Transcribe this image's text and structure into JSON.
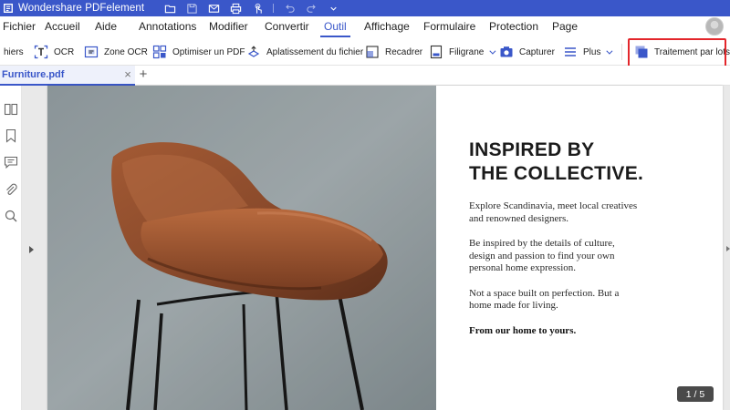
{
  "window": {
    "app_title": "Wondershare PDFelement",
    "app_icon": "pdfelement-logo-icon",
    "quick_access_icons": [
      "folder-icon",
      "save-icon",
      "mail-icon",
      "print-icon",
      "touch-icon",
      "undo-icon",
      "redo-icon",
      "dropdown-icon"
    ]
  },
  "menu": {
    "items": [
      "Fichier",
      "Accueil",
      "Aide",
      "Annotations",
      "Modifier",
      "Convertir",
      "Outil",
      "Affichage",
      "Formulaire",
      "Protection",
      "Page"
    ],
    "active": "Outil"
  },
  "toolbar": {
    "items": [
      {
        "label": "hiers",
        "icon": ""
      },
      {
        "label": "OCR",
        "icon": "ocr-icon"
      },
      {
        "label": "Zone OCR",
        "icon": "zone-ocr-icon"
      },
      {
        "label": "Optimiser un PDF",
        "icon": "optimize-icon"
      },
      {
        "label": "Aplatissement du fichier",
        "icon": "flatten-icon"
      },
      {
        "label": "Recadrer",
        "icon": "crop-icon"
      },
      {
        "label": "Filigrane",
        "icon": "watermark-icon"
      },
      {
        "label": "Capturer",
        "icon": "capture-icon"
      },
      {
        "label": "Plus",
        "icon": "more-icon"
      },
      {
        "label": "Traitement par lots",
        "icon": "batch-icon"
      }
    ],
    "highlight_color": "#e3262b"
  },
  "tabs": {
    "document_tab": "Furniture.pdf",
    "close_symbol": "×",
    "add_symbol": "+"
  },
  "sidebar": {
    "icons": [
      "thumbnails-icon",
      "bookmark-icon",
      "comment-icon",
      "attachment-icon",
      "search-icon"
    ]
  },
  "document": {
    "headline_line1": "INSPIRED BY",
    "headline_line2": "THE COLLECTIVE.",
    "para1_line1": "Explore Scandinavia, meet local creatives",
    "para1_line2": "and renowned designers.",
    "para2_line1": "Be inspired by the details of culture,",
    "para2_line2": "design and passion to find your own",
    "para2_line3": "personal home expression.",
    "para3_line1": "Not a space built on perfection. But a",
    "para3_line2": "home made for living.",
    "para4": "From our home to yours.",
    "page_indicator": "1 / 5"
  },
  "colors": {
    "accent": "#3a57c9",
    "titlebar": "#3a57c9",
    "highlight": "#e3262b",
    "leather": "#8a4a2b"
  }
}
